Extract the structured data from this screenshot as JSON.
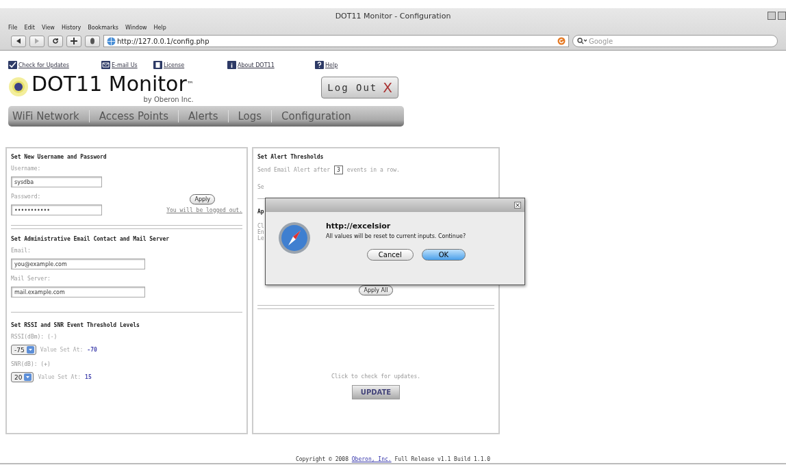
{
  "window": {
    "title": "DOT11 Monitor - Configuration"
  },
  "menu": [
    "File",
    "Edit",
    "View",
    "History",
    "Bookmarks",
    "Window",
    "Help"
  ],
  "toolbar": {
    "url": "http://127.0.0.1/config.php",
    "search_placeholder": "Google"
  },
  "top_links": [
    {
      "label": "Check for Updates"
    },
    {
      "label": "E-mail Us"
    },
    {
      "label": "License"
    },
    {
      "label": "About DOT11"
    },
    {
      "label": "Help"
    }
  ],
  "logo": {
    "name": "DOT11 Monitor",
    "tm": "™",
    "byline": "by Oberon Inc."
  },
  "logout": {
    "label": "Log Out",
    "mark": "X"
  },
  "nav": [
    {
      "label": "WiFi Network",
      "selected": false
    },
    {
      "label": "Access Points",
      "selected": false
    },
    {
      "label": "Alerts",
      "selected": false
    },
    {
      "label": "Logs",
      "selected": false
    },
    {
      "label": "Configuration",
      "selected": false
    }
  ],
  "account": {
    "title": "Set New Username and Password",
    "username_label": "Username:",
    "username": "sysdba",
    "password_label": "Password:",
    "password": "•••••••••••",
    "apply": "Apply",
    "note": "You will be logged out."
  },
  "mail": {
    "title": "Set Administrative Email Contact and Mail Server",
    "email_label": "Email:",
    "email": "you@example.com",
    "server_label": "Mail Server:",
    "server": "mail.example.com"
  },
  "levels": {
    "title": "Set RSSI and SNR Event Threshold Levels",
    "rows": [
      {
        "label": "RSSI(dBm): (-)",
        "select": "-75",
        "value_label": "Value Set At:",
        "value": "-70"
      },
      {
        "label": "SNR(dB): (+)",
        "select": "20",
        "value_label": "Value Set At:",
        "value": "15"
      }
    ]
  },
  "alerts": {
    "title": "Set Alert Thresholds",
    "before": "Send Email Alert after",
    "count": "3",
    "after": "events in a row.",
    "hidden_row": "Se",
    "hidden_heading": "Ap",
    "hidden_lines": [
      "Cl",
      "En",
      "Le"
    ],
    "apply_all": "Apply All"
  },
  "update": {
    "text": "Click to check for updates.",
    "button": "UPDATE"
  },
  "footer": {
    "before": "Copyright © 2008",
    "link": "Oberon, Inc.",
    "after": "Full Release v1.1 Build 1.1.0"
  },
  "dialog": {
    "title": "http://excelsior",
    "message": "All values will be reset to current inputs. Continue?",
    "buttons": [
      {
        "label": "Cancel",
        "kind": "normal"
      },
      {
        "label": "OK",
        "kind": "default"
      }
    ]
  }
}
